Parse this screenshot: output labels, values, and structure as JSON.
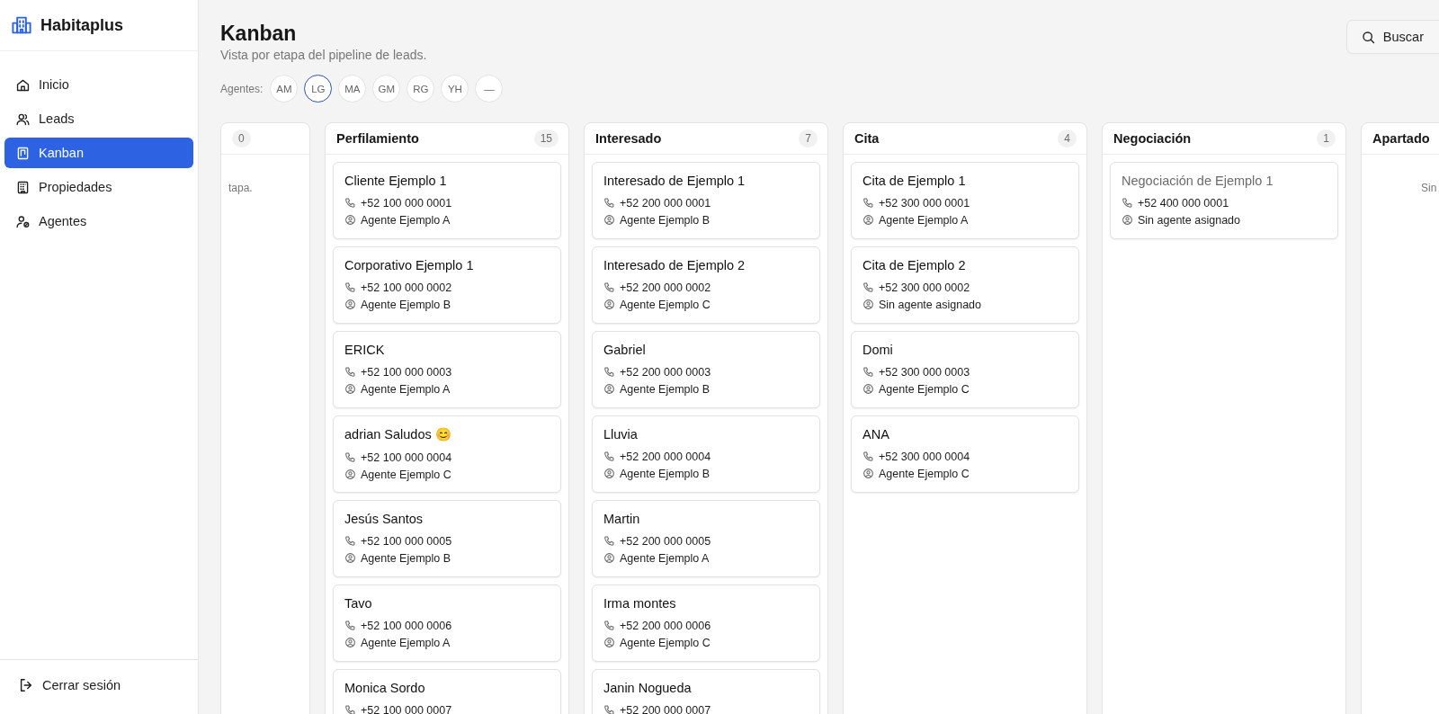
{
  "sidebar": {
    "brand": "Habitaplus",
    "nav": [
      {
        "label": "Inicio",
        "selected": false
      },
      {
        "label": "Leads",
        "selected": false
      },
      {
        "label": "Kanban",
        "selected": true
      },
      {
        "label": "Propiedades",
        "selected": false
      },
      {
        "label": "Agentes",
        "selected": false
      }
    ],
    "logout": "Cerrar sesión"
  },
  "header": {
    "title": "Kanban",
    "subtitle": "Vista por etapa del pipeline de leads.",
    "search": "Buscar"
  },
  "agents": {
    "label": "Agentes:",
    "chips": [
      {
        "label": "AM",
        "selected": false
      },
      {
        "label": "LG",
        "selected": true
      },
      {
        "label": "MA",
        "selected": false
      },
      {
        "label": "GM",
        "selected": false
      },
      {
        "label": "RG",
        "selected": false
      },
      {
        "label": "YH",
        "selected": false
      },
      {
        "label": "—",
        "selected": false
      }
    ]
  },
  "columns": [
    {
      "count": "0",
      "empty_text": "tapa."
    },
    {
      "title": "Perfilamiento",
      "count": "15",
      "cards": [
        {
          "name": "Cliente Ejemplo 1",
          "phone": "+52 100 000 0001",
          "agent": "Agente Ejemplo A",
          "muted": false
        },
        {
          "name": "Corporativo Ejemplo 1",
          "phone": "+52 100 000 0002",
          "agent": "Agente Ejemplo B",
          "muted": false
        },
        {
          "name": "ERICK",
          "phone": "+52 100 000 0003",
          "agent": "Agente Ejemplo A",
          "muted": false
        },
        {
          "name": "adrian Saludos 😊",
          "phone": "+52 100 000 0004",
          "agent": "Agente Ejemplo C",
          "muted": false
        },
        {
          "name": "Jesús Santos",
          "phone": "+52 100 000 0005",
          "agent": "Agente Ejemplo B",
          "muted": false
        },
        {
          "name": "Tavo",
          "phone": "+52 100 000 0006",
          "agent": "Agente Ejemplo A",
          "muted": false
        },
        {
          "name": "Monica Sordo",
          "phone": "+52 100 000 0007",
          "muted": false
        }
      ]
    },
    {
      "title": "Interesado",
      "count": "7",
      "cards": [
        {
          "name": "Interesado de Ejemplo 1",
          "phone": "+52 200 000 0001",
          "agent": "Agente Ejemplo B",
          "muted": false
        },
        {
          "name": "Interesado de Ejemplo 2",
          "phone": "+52 200 000 0002",
          "agent": "Agente Ejemplo C",
          "muted": false
        },
        {
          "name": "Gabriel",
          "phone": "+52 200 000 0003",
          "agent": "Agente Ejemplo B",
          "muted": false
        },
        {
          "name": "Lluvia",
          "phone": "+52 200 000 0004",
          "agent": "Agente Ejemplo B",
          "muted": false
        },
        {
          "name": "Martin",
          "phone": "+52 200 000 0005",
          "agent": "Agente Ejemplo A",
          "muted": false
        },
        {
          "name": "Irma montes",
          "phone": "+52 200 000 0006",
          "agent": "Agente Ejemplo C",
          "muted": false
        },
        {
          "name": "Janin Nogueda",
          "phone": "+52 200 000 0007",
          "muted": false
        }
      ]
    },
    {
      "title": "Cita",
      "count": "4",
      "cards": [
        {
          "name": "Cita de Ejemplo 1",
          "phone": "+52 300 000 0001",
          "agent": "Agente Ejemplo A",
          "muted": false
        },
        {
          "name": "Cita de Ejemplo 2",
          "phone": "+52 300 000 0002",
          "agent": "Sin agente asignado",
          "muted": false
        },
        {
          "name": "Domi",
          "phone": "+52 300 000 0003",
          "agent": "Agente Ejemplo C",
          "muted": false
        },
        {
          "name": "ANA",
          "phone": "+52 300 000 0004",
          "agent": "Agente Ejemplo C",
          "muted": false
        }
      ]
    },
    {
      "title": "Negociación",
      "count": "1",
      "cards": [
        {
          "name": "Negociación de Ejemplo 1",
          "phone": "+52 400 000 0001",
          "agent": "Sin agente asignado",
          "muted": true
        }
      ]
    },
    {
      "title": "Apartado",
      "empty_text": "Sin"
    }
  ]
}
